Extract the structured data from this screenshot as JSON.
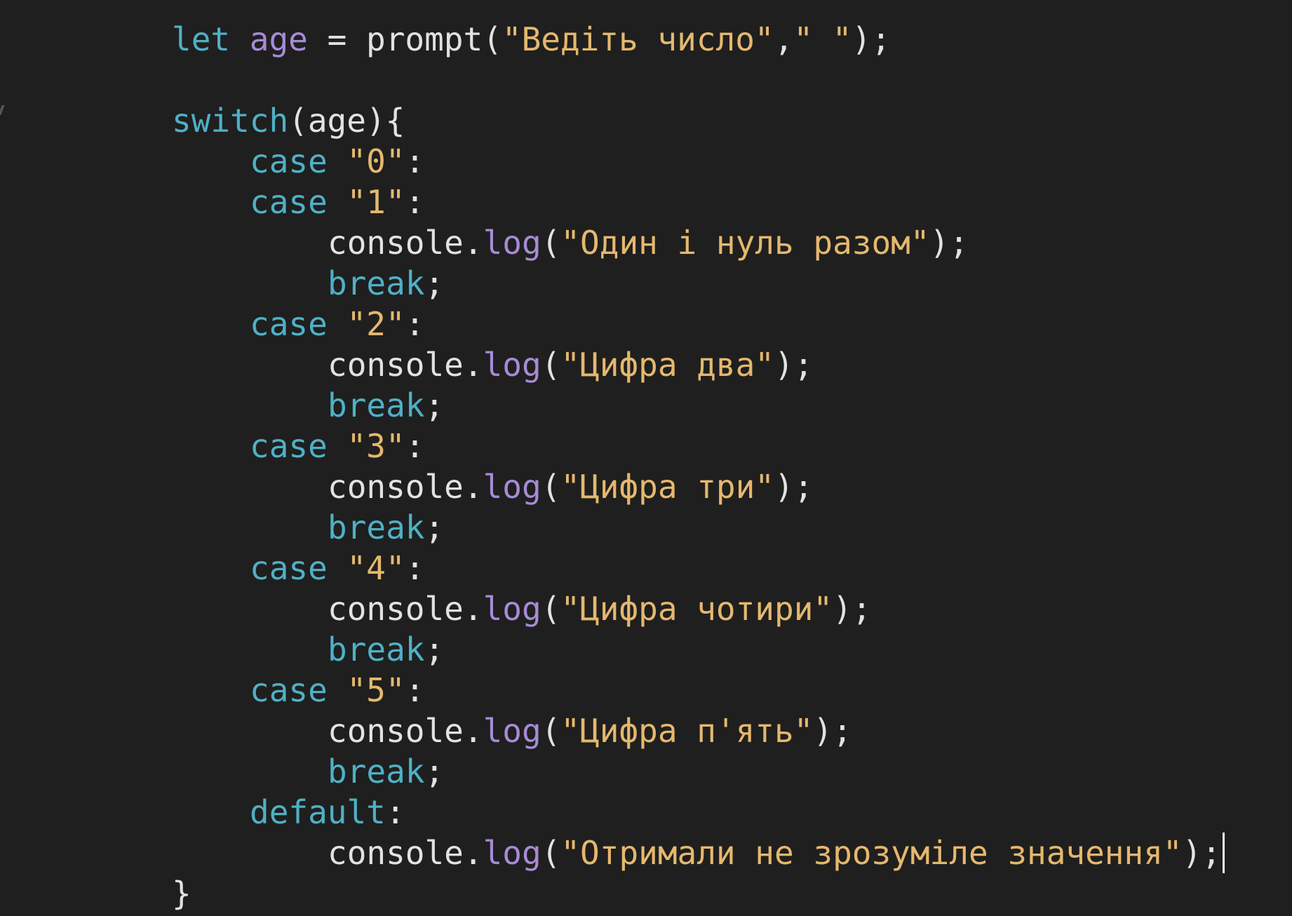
{
  "colors": {
    "background": "#1f1f1f",
    "keyword": "#4fb0c6",
    "variable": "#a78bd6",
    "method": "#a78bd6",
    "string": "#e5b86e",
    "plain": "#e2e2e2"
  },
  "code": {
    "line1": {
      "kw": "let",
      "var": "age",
      "eq": "=",
      "fn": "prompt(",
      "str1": "\"Ведіть число\"",
      "comma": ",",
      "str2": "\" \"",
      "end": ");"
    },
    "line2": {
      "kw": "switch",
      "rest": "(age){"
    },
    "cases": [
      {
        "kw": "case",
        "str": "\"0\"",
        "colon": ":"
      },
      {
        "kw": "case",
        "str": "\"1\"",
        "colon": ":"
      },
      {
        "kw": "case",
        "str": "\"2\"",
        "colon": ":"
      },
      {
        "kw": "case",
        "str": "\"3\"",
        "colon": ":"
      },
      {
        "kw": "case",
        "str": "\"4\"",
        "colon": ":"
      },
      {
        "kw": "case",
        "str": "\"5\"",
        "colon": ":"
      }
    ],
    "logs": [
      {
        "obj": "console.",
        "method": "log",
        "open": "(",
        "str": "\"Один і нуль разом\"",
        "close": ");"
      },
      {
        "obj": "console.",
        "method": "log",
        "open": "(",
        "str": "\"Цифра два\"",
        "close": ");"
      },
      {
        "obj": "console.",
        "method": "log",
        "open": "(",
        "str": "\"Цифра три\"",
        "close": ");"
      },
      {
        "obj": "console.",
        "method": "log",
        "open": "(",
        "str": "\"Цифра чотири\"",
        "close": ");"
      },
      {
        "obj": "console.",
        "method": "log",
        "open": "(",
        "str": "\"Цифра п'ять\"",
        "close": ");"
      },
      {
        "obj": "console.",
        "method": "log",
        "open": "(",
        "str": "\"Отримали не зрозуміле значення\"",
        "close": ");"
      }
    ],
    "break_kw": "break",
    "break_semi": ";",
    "default_kw": "default",
    "default_colon": ":",
    "close_brace": "}"
  }
}
